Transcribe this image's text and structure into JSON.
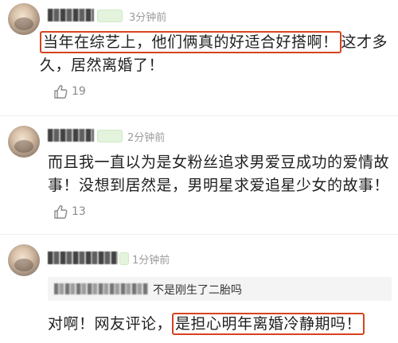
{
  "comments": [
    {
      "timestamp": "3分钟前",
      "text_highlight": "当年在综艺上，他们俩真的好适合好搭啊！",
      "text_rest": "这才多久，居然离婚了！",
      "likes": "19"
    },
    {
      "timestamp": "2分钟前",
      "text": "而且我一直以为是女粉丝追求男爱豆成功的爱情故事！没想到居然是，男明星求爱追星少女的故事！",
      "likes": "13"
    },
    {
      "timestamp": "1分钟前",
      "quote_text": "不是刚生了二胎吗",
      "text_before": "对啊！网友评论，",
      "text_highlight": "是担心明年离婚冷静期吗！"
    }
  ],
  "colors": {
    "highlight_border": "#d6431f",
    "timestamp": "#9a9a9a",
    "body_text": "#1f1f1f",
    "badge_bg": "#e4f4dc"
  },
  "icons": {
    "like": "thumbs-up-outline"
  }
}
